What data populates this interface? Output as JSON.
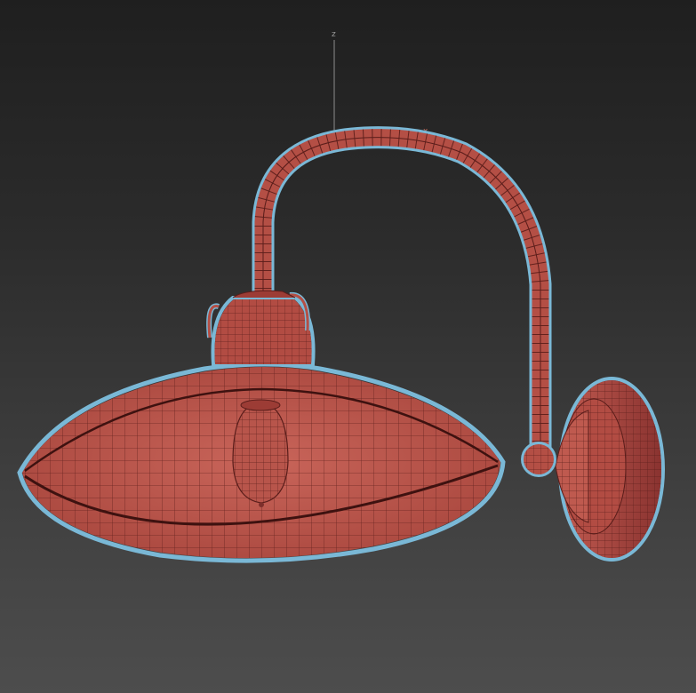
{
  "viewport": {
    "axis_labels": {
      "z": "z",
      "x": "x"
    },
    "background": {
      "top": "#1f1f1f",
      "bottom": "#4d4d4d"
    }
  },
  "model": {
    "name": "wall-lamp",
    "colors": {
      "fill": "#b44f45",
      "fill_light": "#c9655a",
      "fill_dark": "#7d2f2b",
      "wire": "#5a1d1a",
      "selection_outline": "#7ab8d6"
    }
  }
}
